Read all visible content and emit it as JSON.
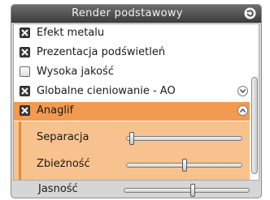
{
  "panel": {
    "title": "Render podstawowy",
    "reset_icon": "reset-icon"
  },
  "options": [
    {
      "label": "Efekt metalu",
      "checked": true
    },
    {
      "label": "Prezentacja podświetleń",
      "checked": true
    },
    {
      "label": "Wysoka jakość",
      "checked": false
    },
    {
      "label": "Globalne cieniowanie - AO",
      "checked": true,
      "expand_icon": "chevron-down-icon"
    },
    {
      "label": "Anaglif",
      "checked": true,
      "expand_icon": "chevron-up-icon",
      "highlighted": true
    }
  ],
  "anaglyph": {
    "separation_label": "Separacja",
    "separation_value": 0.02,
    "convergence_label": "Zbieżność",
    "convergence_value": 0.5
  },
  "brightness": {
    "label": "Jasność",
    "value": 0.55
  },
  "colors": {
    "title_bar": "#4f4f4f",
    "highlight": "#f29a4f",
    "highlight_light": "#f8c28e"
  }
}
